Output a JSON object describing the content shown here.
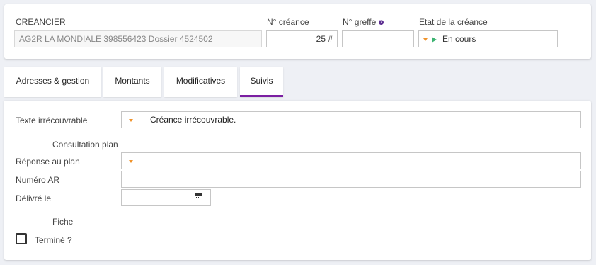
{
  "header": {
    "creancier_label": "CREANCIER",
    "creancier_value": "AG2R LA MONDIALE 398556423  Dossier 4524502",
    "numero_creance_label": "N° créance",
    "numero_creance_value": "25 #",
    "numero_greffe_label": "N° greffe",
    "numero_greffe_value": "",
    "help_icon_glyph": "?",
    "etat_label": "Etat de la créance",
    "etat_value": "En cours"
  },
  "tabs": [
    {
      "label": "Adresses & gestion",
      "active": false
    },
    {
      "label": "Montants",
      "active": false
    },
    {
      "label": "Modificatives",
      "active": false
    },
    {
      "label": "Suivis",
      "active": true
    }
  ],
  "form": {
    "texte_irrecouvrable_label": "Texte irrécouvrable",
    "texte_irrecouvrable_value": "Créance irrécouvrable.",
    "consultation_plan_section": "Consultation plan",
    "reponse_plan_label": "Réponse au plan",
    "reponse_plan_value": "",
    "numero_ar_label": "Numéro AR",
    "numero_ar_value": "",
    "delivre_le_label": "Délivré le",
    "delivre_le_value": "",
    "fiche_section": "Fiche",
    "termine_label": "Terminé ?",
    "termine_checked": false
  },
  "colors": {
    "accent": "#7b1fa2",
    "caret": "#f0932b",
    "status_play": "#3cb371",
    "help_icon": "#5c2d91"
  }
}
